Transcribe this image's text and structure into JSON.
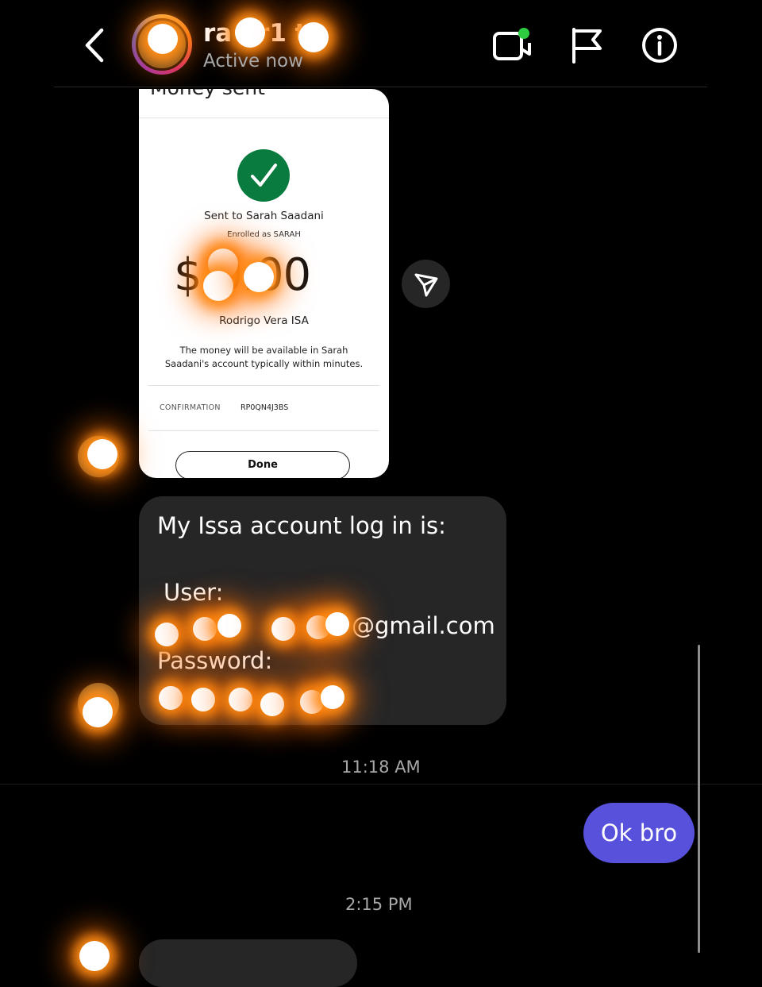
{
  "header": {
    "username": "ra  er1  t",
    "status": "Active now",
    "icons": [
      "back-arrow-icon",
      "video-call-icon",
      "flag-icon",
      "info-icon"
    ],
    "online_color": "#2ecc40"
  },
  "shared_screenshot": {
    "title": "Money sent",
    "sent_to": "Sent to Sarah Saadani",
    "enrolled": "Enrolled as SARAH",
    "amount": "$  0.00",
    "sender": "Rodrigo Vera ISA",
    "availability": "The money will be available in Sarah Saadani's account typically within minutes.",
    "confirmation_label": "CONFIRMATION",
    "confirmation_value": "RP0QN4J3BS",
    "done_label": "Done",
    "check_color": "#0a7b3e"
  },
  "message": {
    "line1": "My Issa account log in is:",
    "line2": "User:",
    "line3": "@gmail.com",
    "line4": "Password:",
    "line5": ""
  },
  "timestamps": {
    "first": "11:18 AM",
    "second": "2:15 PM"
  },
  "reply": {
    "text": "Ok bro",
    "color": "#5851db"
  }
}
